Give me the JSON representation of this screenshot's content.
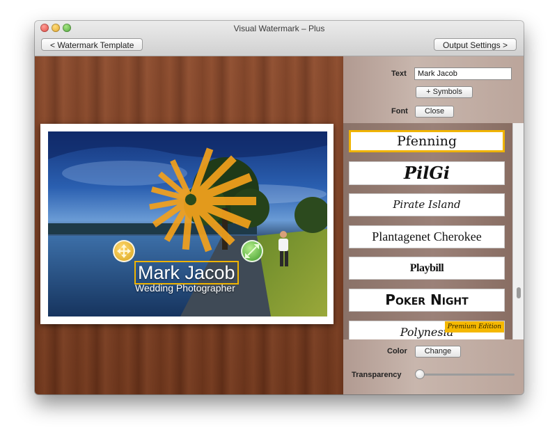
{
  "window": {
    "title": "Visual Watermark – Plus"
  },
  "toolbar": {
    "back_label": "< Watermark Template",
    "output_label": "Output Settings >"
  },
  "watermark": {
    "name": "Mark Jacob",
    "subtitle": "Wedding Photographer"
  },
  "panel": {
    "text_label": "Text",
    "text_value": "Mark Jacob",
    "symbols_label": "+ Symbols",
    "font_label": "Font",
    "font_close_label": "Close",
    "fonts": [
      {
        "name": "Pfenning",
        "selected": true
      },
      {
        "name": "PilGi"
      },
      {
        "name": "Pirate Island"
      },
      {
        "name": "Plantagenet Cherokee"
      },
      {
        "name": "Playbill"
      },
      {
        "name": "Poker Night"
      },
      {
        "name": "Polynesia",
        "badge": "Premium Edition"
      }
    ],
    "color_label": "Color",
    "color_change_label": "Change",
    "transparency_label": "Transparency",
    "transparency_value": 0
  },
  "colors": {
    "accent": "#f0b400",
    "wood": "#7a3c1f",
    "panel": "#c8b6ad"
  }
}
